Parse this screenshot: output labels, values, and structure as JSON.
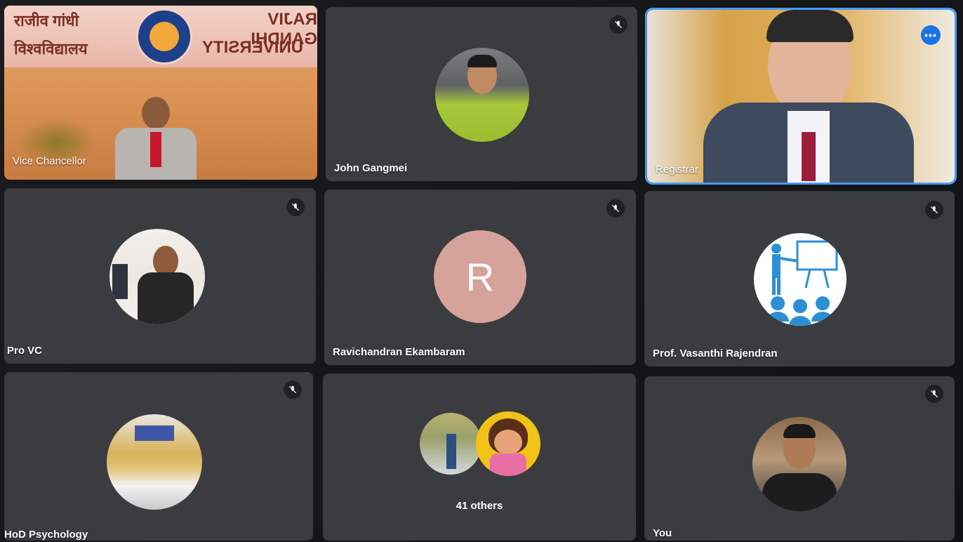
{
  "meeting": {
    "tiles": [
      {
        "name": "Vice Chancellor"
      },
      {
        "name": "John Gangmei"
      },
      {
        "name": "Registrar"
      },
      {
        "name": "Pro VC"
      },
      {
        "name": "Ravichandran Ekambaram",
        "initial": "R"
      },
      {
        "name": "Prof. Vasanthi Rajendran"
      },
      {
        "name": "HoD Psychology"
      },
      {
        "name": "",
        "others_label": "41 others"
      },
      {
        "name": "You"
      }
    ],
    "banner": {
      "hindi_line1": "राजीव गांधी",
      "hindi_line2": "विश्वविद्यालय",
      "english_line1": "RAJIV GANDHI",
      "english_line2": "UNIVERSITY"
    },
    "more_options": "•••"
  },
  "icons": [
    "mic-off-icon",
    "more-options-icon",
    "presenter-icon"
  ],
  "colors": {
    "tile_bg": "#3a3c3f",
    "speaking_border": "#4a9af5",
    "letter_avatar": "#d5a39a",
    "more_button": "#1a73e8"
  }
}
